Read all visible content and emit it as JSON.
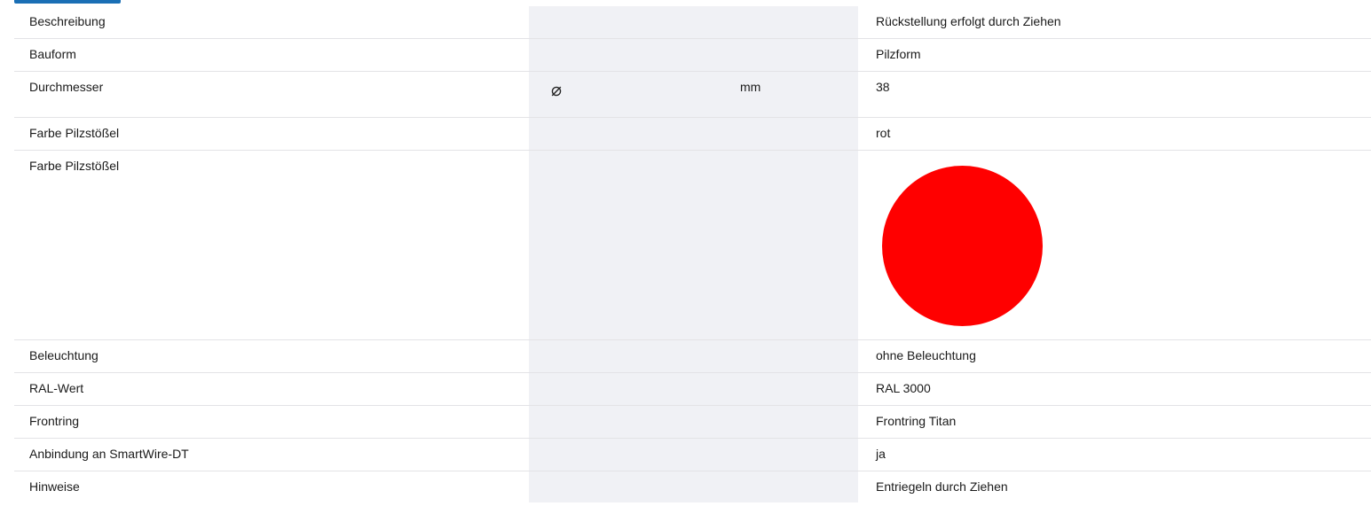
{
  "colors": {
    "swatch": "#ff0000",
    "center_column_bg": "#f0f1f5",
    "row_divider": "#e3e3e6",
    "title_accent": "#1a6fb5"
  },
  "rows": [
    {
      "label": "Beschreibung",
      "symbol": "",
      "unit": "",
      "value": "Rückstellung erfolgt durch Ziehen"
    },
    {
      "label": "Bauform",
      "symbol": "",
      "unit": "",
      "value": "Pilzform"
    },
    {
      "label": "Durchmesser",
      "symbol": "⌀",
      "unit": "mm",
      "value": "38"
    },
    {
      "label": "Farbe Pilzstößel",
      "symbol": "",
      "unit": "",
      "value": "rot"
    },
    {
      "label": "Farbe Pilzstößel",
      "symbol": "",
      "unit": "",
      "value": "",
      "swatch": "color-swatch-red"
    },
    {
      "label": "Beleuchtung",
      "symbol": "",
      "unit": "",
      "value": "ohne Beleuchtung"
    },
    {
      "label": "RAL-Wert",
      "symbol": "",
      "unit": "",
      "value": "RAL 3000"
    },
    {
      "label": "Frontring",
      "symbol": "",
      "unit": "",
      "value": "Frontring Titan"
    },
    {
      "label": "Anbindung an SmartWire-DT",
      "symbol": "",
      "unit": "",
      "value": "ja"
    },
    {
      "label": "Hinweise",
      "symbol": "",
      "unit": "",
      "value": "Entriegeln durch Ziehen"
    }
  ]
}
